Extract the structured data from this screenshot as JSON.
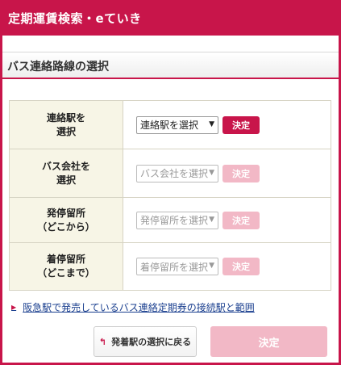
{
  "header": {
    "title": "定期運賃検索・eていき"
  },
  "section": {
    "title": "バス連絡路線の選択"
  },
  "rows": [
    {
      "label": "連絡駅を\n選択",
      "select": "連絡駅を選択",
      "button": "決定",
      "enabled": true
    },
    {
      "label": "バス会社を\n選択",
      "select": "バス会社を選択",
      "button": "決定",
      "enabled": false
    },
    {
      "label": "発停留所\n（どこから）",
      "select": "発停留所を選択",
      "button": "決定",
      "enabled": false
    },
    {
      "label": "着停留所\n（どこまで）",
      "select": "着停留所を選択",
      "button": "決定",
      "enabled": false
    }
  ],
  "link": {
    "text": "阪急駅で発売しているバス連絡定期券の接続駅と範囲"
  },
  "footer": {
    "back_label": "発着駅の選択に戻る",
    "submit_label": "決定"
  },
  "colors": {
    "accent": "#c8154a",
    "disabled": "#f2b8c6",
    "label_bg": "#f7f5e6"
  }
}
